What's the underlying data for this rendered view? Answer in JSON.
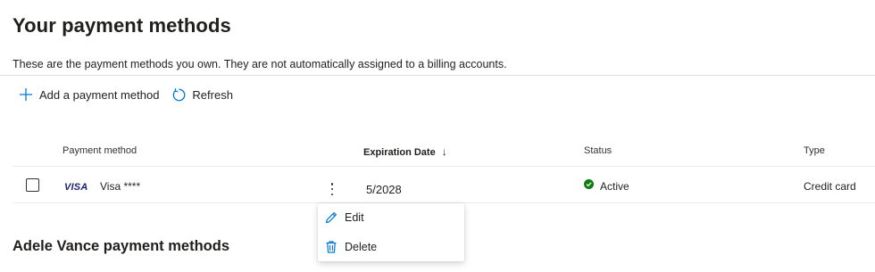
{
  "page": {
    "title": "Your payment methods",
    "description": "These are the payment methods you own. They are not automatically assigned to a billing accounts."
  },
  "toolbar": {
    "add_label": "Add a payment method",
    "refresh_label": "Refresh"
  },
  "table": {
    "columns": {
      "payment_method": "Payment method",
      "expiration_date": "Expiration Date",
      "status": "Status",
      "type": "Type"
    },
    "sort_indicator": "↓",
    "rows": [
      {
        "brand_logo": "VISA",
        "name": "Visa ****",
        "expiration": "5/2028",
        "status": "Active",
        "type": "Credit card"
      }
    ]
  },
  "context_menu": {
    "edit_label": "Edit",
    "delete_label": "Delete"
  },
  "secondary_section": {
    "title": "Adele Vance payment methods"
  },
  "colors": {
    "accent": "#0078d4",
    "status_active": "#107c10",
    "visa_blue": "#1a1f71",
    "divider": "#e1dfdd"
  },
  "icons": {
    "add": "plus-icon",
    "refresh": "refresh-icon",
    "sort": "arrow-down-icon",
    "more": "more-vertical-icon",
    "status": "checkmark-circle-icon",
    "edit": "pencil-icon",
    "delete": "trash-icon"
  }
}
